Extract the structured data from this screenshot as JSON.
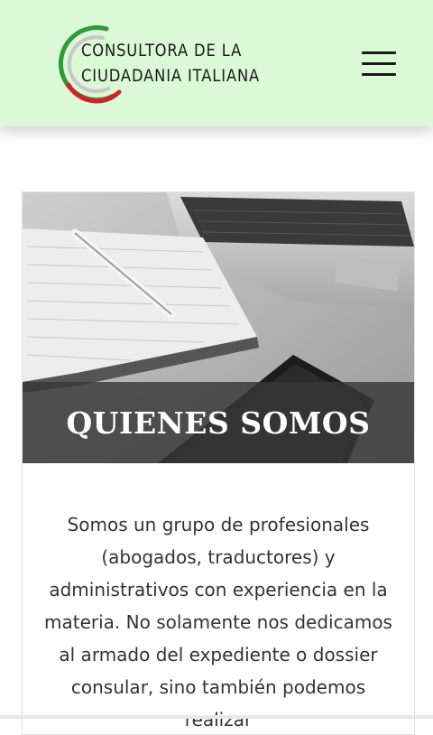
{
  "header": {
    "logo_line1": "CONSULTORA DE LA",
    "logo_line2": "CIUDADANIA ITALIANA",
    "menu_icon": "hamburger-icon",
    "colors": {
      "background": "#dbf8d7",
      "flag_green": "#2e9a3a",
      "flag_red": "#d32027"
    }
  },
  "card": {
    "title": "QUIENES SOMOS",
    "body": "Somos un grupo de profesionales (abogados, traductores) y administrativos con experiencia en la materia. No solamente nos dedicamos al armado del expediente o dossier consular, sino también podemos realizar"
  }
}
